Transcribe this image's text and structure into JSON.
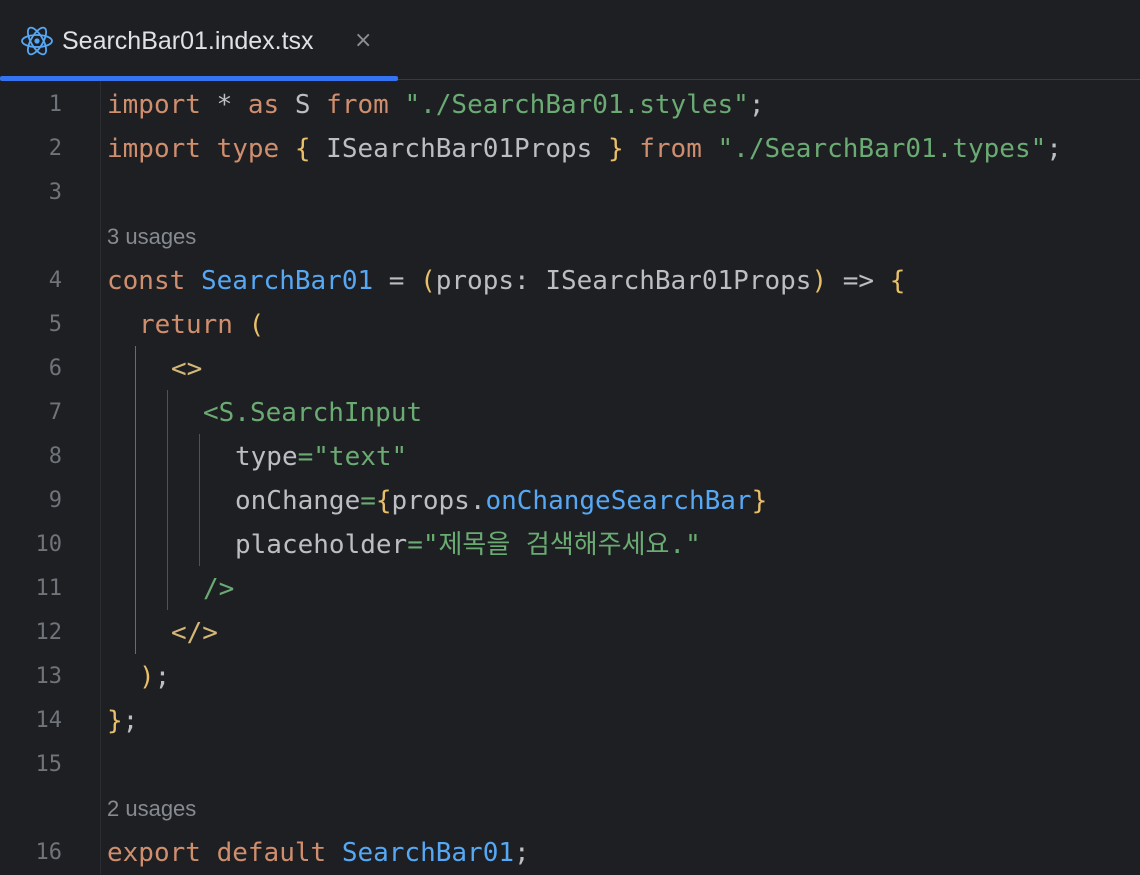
{
  "tab": {
    "title": "SearchBar01.index.tsx",
    "icon": "react-icon",
    "close_glyph": "×",
    "accent": "#3574f0"
  },
  "editor": {
    "line_numbers": [
      "1",
      "2",
      "3",
      "4",
      "5",
      "6",
      "7",
      "8",
      "9",
      "10",
      "11",
      "12",
      "13",
      "14",
      "15",
      "16"
    ],
    "hints": [
      "3 usages",
      "2 usages"
    ],
    "lines": {
      "l1": {
        "kw1": "import",
        "t1": " * ",
        "kw2": "as",
        "t2": " S ",
        "kw3": "from",
        "t3": " ",
        "s1": "\"./SearchBar01.styles\"",
        "t4": ";"
      },
      "l2": {
        "kw1": "import",
        "t1": " ",
        "kw2": "type",
        "t2": " ",
        "b1": "{",
        "t3": " ISearchBar01Props ",
        "b2": "}",
        "t4": " ",
        "kw3": "from",
        "t5": " ",
        "s1": "\"./SearchBar01.types\"",
        "t6": ";"
      },
      "l4": {
        "kw1": "const",
        "t1": " ",
        "fn": "SearchBar01",
        "t2": " = ",
        "b1": "(",
        "t3": "props: ISearchBar01Props",
        "b2": ")",
        "t4": " => ",
        "b3": "{"
      },
      "l5": {
        "kw1": "return",
        "t1": " ",
        "b1": "("
      },
      "l6": {
        "tag": "<>"
      },
      "l7": {
        "tag": "<S.SearchInput"
      },
      "l8": {
        "attr": "type",
        "eq": "=",
        "s1": "\"text\""
      },
      "l9": {
        "attr": "onChange",
        "eq": "=",
        "b1": "{",
        "t1": "props.",
        "fn": "onChangeSearchBar",
        "b2": "}"
      },
      "l10": {
        "attr": "placeholder",
        "eq": "=",
        "s1": "\"제목을 검색해주세요.\""
      },
      "l11": {
        "tag": "/>"
      },
      "l12": {
        "tag": "</>"
      },
      "l13": {
        "b1": ")",
        "t1": ";"
      },
      "l14": {
        "b1": "}",
        "t1": ";"
      },
      "l16": {
        "kw1": "export",
        "t1": " ",
        "kw2": "default",
        "t2": " ",
        "fn": "SearchBar01",
        "t3": ";"
      }
    }
  },
  "colors": {
    "background": "#1e1f22",
    "keyword": "#cf8e6d",
    "string": "#6aab73",
    "function": "#56a8f5",
    "bracket": "#e8bf6a",
    "text": "#bcbec4",
    "line_number": "#6f737a"
  }
}
